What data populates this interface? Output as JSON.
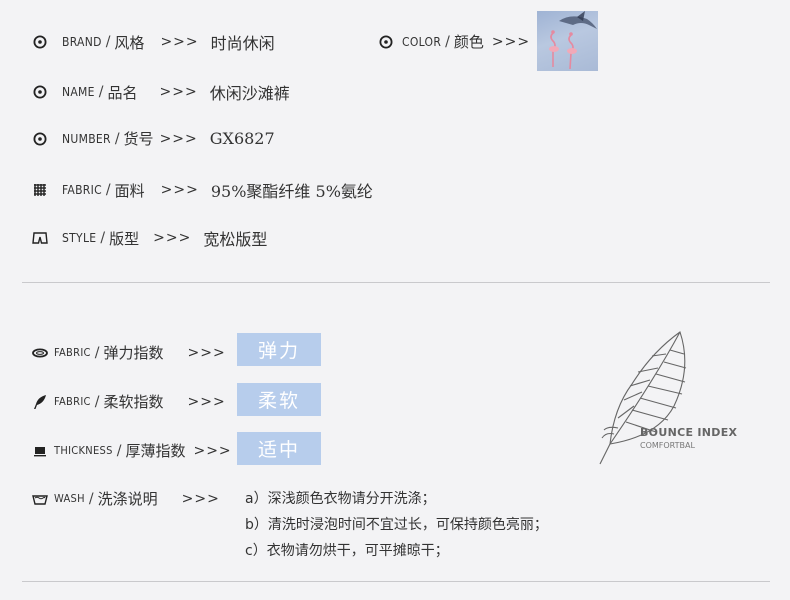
{
  "attributes": [
    {
      "en": "BRAND",
      "zh": "风格",
      "arrows": ">>>",
      "value": "时尚休闲",
      "icon": "target-circle-icon"
    },
    {
      "en": "NAME",
      "zh": "品名",
      "arrows": ">>>",
      "value": "休闲沙滩裤",
      "icon": "target-circle-icon"
    },
    {
      "en": "NUMBER",
      "zh": "货号",
      "arrows": ">>>",
      "value": "GX6827",
      "icon": "target-circle-icon"
    },
    {
      "en": "FABRIC",
      "zh": "面料",
      "arrows": ">>>",
      "value": "95%聚酯纤维 5%氨纶",
      "icon": "grid-icon"
    },
    {
      "en": "STYLE",
      "zh": "版型",
      "arrows": ">>>",
      "value": "宽松版型",
      "icon": "shorts-icon"
    }
  ],
  "color": {
    "en": "COLOR",
    "zh": "颜色",
    "arrows": ">>>",
    "icon": "target-circle-icon",
    "swatch_desc": "flamingo-print-swatch"
  },
  "indices": [
    {
      "en": "FABRIC",
      "zh": "弹力指数",
      "arrows": ">>>",
      "value": "弹力",
      "icon": "ring-icon"
    },
    {
      "en": "FABRIC",
      "zh": "柔软指数",
      "arrows": ">>>",
      "value": "柔软",
      "icon": "feather-icon"
    },
    {
      "en": "THICKNESS",
      "zh": "厚薄指数",
      "arrows": ">>>",
      "value": "适中",
      "icon": "block-icon"
    }
  ],
  "wash": {
    "en": "WASH",
    "zh": "洗涤说明",
    "arrows": ">>>",
    "icon": "basin-icon",
    "lines": [
      "a）深浅颜色衣物请分开洗涤；",
      "b）清洗时浸泡时间不宜过长，可保持颜色亮丽；",
      "c）衣物请勿烘干，可平摊晾干；"
    ]
  },
  "bounce": {
    "title": "BOUNCE INDEX",
    "subtitle": "COMFORTBAL"
  },
  "colors": {
    "background": "#f3f3f5",
    "badge": "#b7cdec",
    "text": "#333333",
    "divider": "#c9c9cc"
  }
}
